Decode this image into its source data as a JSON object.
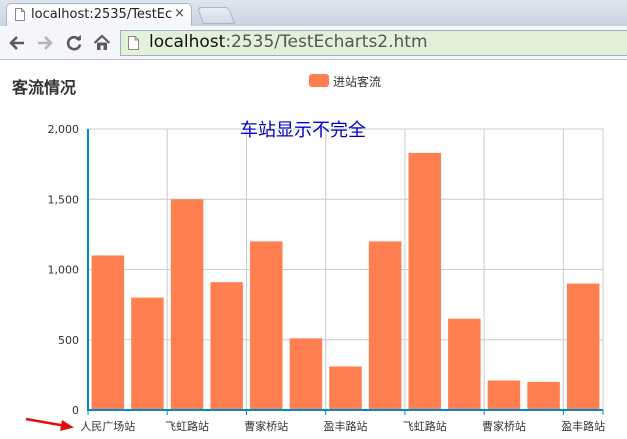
{
  "browser": {
    "tab_title": "localhost:2535/TestEc",
    "tab_close": "×",
    "url_host": "localhost",
    "url_rest": ":2535/TestEcharts2.htm"
  },
  "page": {
    "title": "客流情况",
    "annotation": "车站显示不完全"
  },
  "colors": {
    "bar": "#ff7f50",
    "axis": "#008acd",
    "grid": "#cccccc",
    "arrow": "#e01010"
  },
  "chart_data": {
    "type": "bar",
    "title": "客流情况",
    "legend": [
      "进站客流"
    ],
    "legend_position": "top-center",
    "ylim": [
      0,
      2000
    ],
    "yticks": [
      "0",
      "500",
      "1,000",
      "1,500",
      "2,000"
    ],
    "ytick_values": [
      0,
      500,
      1000,
      1500,
      2000
    ],
    "x_tick_labels": [
      "人民广场站",
      "飞虹路站",
      "曹家桥站",
      "盈丰路站",
      "飞虹路站",
      "曹家桥站",
      "盈丰路站"
    ],
    "series": [
      {
        "name": "进站客流",
        "values": [
          1100,
          800,
          1500,
          910,
          1200,
          510,
          310,
          1200,
          1830,
          650,
          210,
          200,
          900
        ]
      }
    ],
    "grid": true
  }
}
